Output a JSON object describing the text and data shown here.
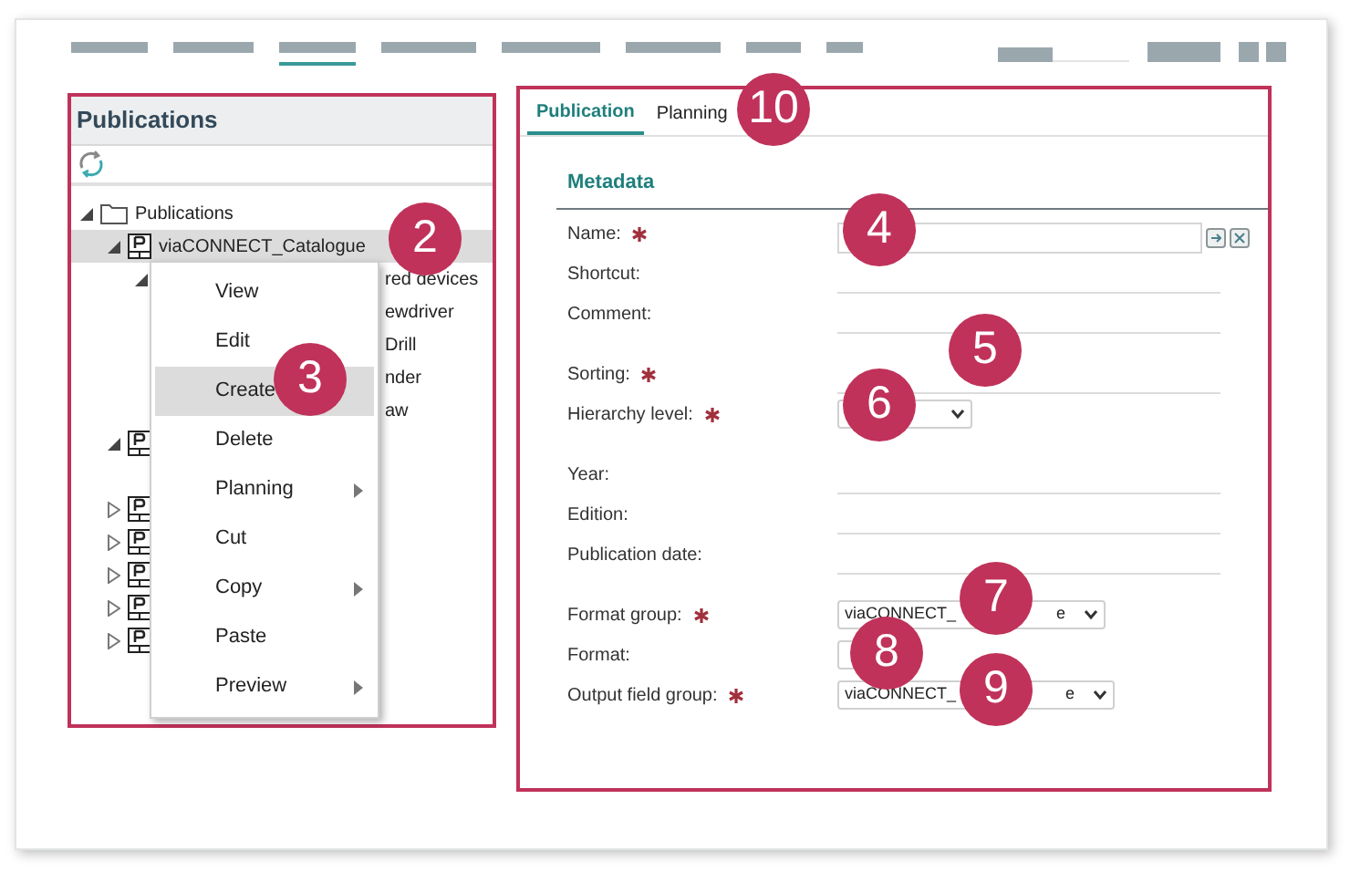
{
  "top_nav": [
    {
      "selected": false
    },
    {
      "selected": false
    },
    {
      "selected": true
    },
    {
      "selected": false
    },
    {
      "selected": false
    },
    {
      "selected": false
    },
    {
      "selected": false
    },
    {
      "selected": false
    }
  ],
  "publications_panel": {
    "title": "Publications",
    "tree": [
      {
        "label": "Publications",
        "expanded": true,
        "children": [
          {
            "label": "viaCONNECT_Catalogue",
            "selected": true,
            "expanded": true,
            "children": [
              {
                "label": "red devices",
                "expanded": true,
                "children": [
                  {
                    "label": "ewdriver"
                  },
                  {
                    "label": "Drill"
                  },
                  {
                    "label": "nder"
                  },
                  {
                    "label": "aw"
                  }
                ]
              }
            ]
          },
          {
            "expanded": true
          },
          {
            "expanded": false
          },
          {
            "expanded": false
          },
          {
            "expanded": false
          },
          {
            "expanded": false
          },
          {
            "expanded": false
          }
        ]
      }
    ]
  },
  "context_menu": [
    {
      "label": "View",
      "selected": false,
      "submenu": false
    },
    {
      "label": "Edit",
      "selected": false,
      "submenu": false
    },
    {
      "label": "Create",
      "selected": true,
      "submenu": false
    },
    {
      "label": "Delete",
      "selected": false,
      "submenu": false
    },
    {
      "label": "Planning",
      "selected": false,
      "submenu": true
    },
    {
      "label": "Cut",
      "selected": false,
      "submenu": false
    },
    {
      "label": "Copy",
      "selected": false,
      "submenu": true
    },
    {
      "label": "Paste",
      "selected": false,
      "submenu": false
    },
    {
      "label": "Preview",
      "selected": false,
      "submenu": true
    }
  ],
  "tabs": [
    {
      "label": "Publication",
      "selected": true
    },
    {
      "label": "Planning",
      "selected": false
    }
  ],
  "section": "Metadata",
  "field_groups": [
    [
      {
        "label": "Name:",
        "required": true,
        "kind": "input"
      },
      {
        "label": "Shortcut:",
        "required": false,
        "kind": "line"
      },
      {
        "label": "Comment:",
        "required": false,
        "kind": "line"
      }
    ],
    [
      {
        "label": "Sorting:",
        "required": true,
        "kind": "line"
      },
      {
        "label": "Hierarchy level:",
        "required": true,
        "kind": "select"
      }
    ],
    [
      {
        "label": "Year:",
        "required": false,
        "kind": "line"
      },
      {
        "label": "Edition:",
        "required": false,
        "kind": "line"
      },
      {
        "label": "Publication date:",
        "required": false,
        "kind": "line"
      }
    ],
    [
      {
        "label": "Format group:",
        "required": true,
        "kind": "select",
        "value": "viaCONNECT_",
        "value_end": "e"
      },
      {
        "label": "Format:",
        "required": false,
        "kind": "small"
      },
      {
        "label": "Output field group:",
        "required": true,
        "kind": "select",
        "value": "viaCONNECT_",
        "value_end": "e"
      }
    ]
  ],
  "callouts": [
    "2",
    "3",
    "10",
    "4",
    "5",
    "6",
    "7",
    "8",
    "9"
  ]
}
